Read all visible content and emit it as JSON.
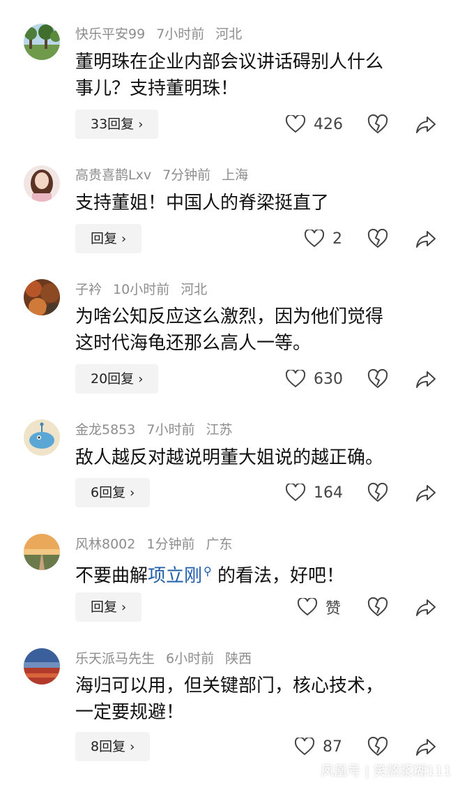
{
  "comments": [
    {
      "username": "快乐平安99",
      "time": "7小时前",
      "location": "河北",
      "text_lines": [
        "董明珠在企业内部会议讲话碍别人什么",
        "事儿？支持董明珠！"
      ],
      "reply_label": "33回复",
      "likes": "426",
      "avatar_icon": "field-trees-photo"
    },
    {
      "username": "高贵喜鹊Lxv",
      "time": "7分钟前",
      "location": "上海",
      "text_lines": [
        "支持董姐！中国人的脊梁挺直了"
      ],
      "reply_label": "回复",
      "likes": "2",
      "avatar_icon": "woman-portrait"
    },
    {
      "username": "子衿",
      "time": "10小时前",
      "location": "河北",
      "text_lines": [
        "为啥公知反应这么激烈，因为他们觉得",
        "这时代海龟还那么高人一等。"
      ],
      "reply_label": "20回复",
      "likes": "630",
      "avatar_icon": "autumn-leaves-photo"
    },
    {
      "username": "金龙5853",
      "time": "7小时前",
      "location": "江苏",
      "text_lines": [
        "敌人越反对越说明董大姐说的越正确。"
      ],
      "reply_label": "6回复",
      "likes": "164",
      "avatar_icon": "cartoon-fish"
    },
    {
      "username": "风林8002",
      "time": "1分钟前",
      "location": "广东",
      "text_before": "不要曲解",
      "mention": "项立刚",
      "text_after": " 的看法，好吧！",
      "reply_label": "回复",
      "likes": "赞",
      "avatar_icon": "boardwalk-sunset-photo"
    },
    {
      "username": "乐天派马先生",
      "time": "6小时前",
      "location": "陕西",
      "text_lines": [
        "海归可以用，但关键部门，核心技术，",
        "一定要规避！"
      ],
      "reply_label": "8回复",
      "likes": "87",
      "avatar_icon": "red-landscape-photo"
    }
  ],
  "watermark": "凤凰号 | 笑熬浆糊111",
  "colors": {
    "meta_gray": "#8d8d8d",
    "reply_bg": "#f3f3f3",
    "mention_blue": "#1f5ea8"
  }
}
